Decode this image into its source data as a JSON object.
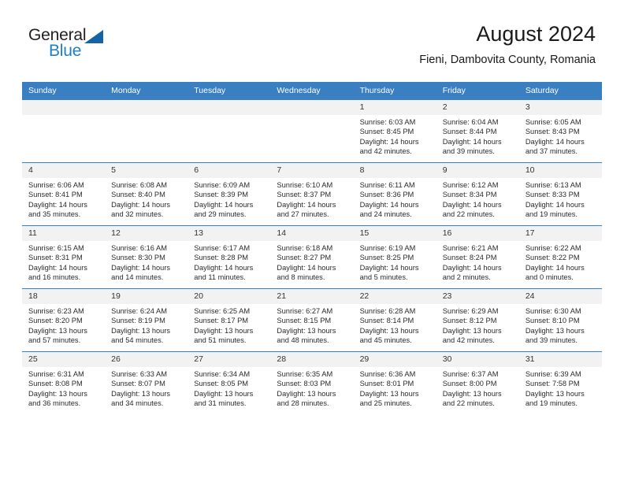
{
  "brand": {
    "name_part1": "General",
    "name_part2": "Blue",
    "triangle_color": "#1464a5",
    "blue_color": "#1f7fc4"
  },
  "header": {
    "title": "August 2024",
    "subtitle": "Fieni, Dambovita County, Romania",
    "header_bg": "#3a7fc1",
    "daynum_bg": "#f2f2f2"
  },
  "weekday_headers": [
    "Sunday",
    "Monday",
    "Tuesday",
    "Wednesday",
    "Thursday",
    "Friday",
    "Saturday"
  ],
  "labels": {
    "sunrise": "Sunrise:",
    "sunset": "Sunset:",
    "daylight": "Daylight:"
  },
  "weeks": [
    [
      {
        "day": "",
        "blank": true
      },
      {
        "day": "",
        "blank": true
      },
      {
        "day": "",
        "blank": true
      },
      {
        "day": "",
        "blank": true
      },
      {
        "day": "1",
        "sunrise": "Sunrise: 6:03 AM",
        "sunset": "Sunset: 8:45 PM",
        "daylight": "Daylight: 14 hours and 42 minutes."
      },
      {
        "day": "2",
        "sunrise": "Sunrise: 6:04 AM",
        "sunset": "Sunset: 8:44 PM",
        "daylight": "Daylight: 14 hours and 39 minutes."
      },
      {
        "day": "3",
        "sunrise": "Sunrise: 6:05 AM",
        "sunset": "Sunset: 8:43 PM",
        "daylight": "Daylight: 14 hours and 37 minutes."
      }
    ],
    [
      {
        "day": "4",
        "sunrise": "Sunrise: 6:06 AM",
        "sunset": "Sunset: 8:41 PM",
        "daylight": "Daylight: 14 hours and 35 minutes."
      },
      {
        "day": "5",
        "sunrise": "Sunrise: 6:08 AM",
        "sunset": "Sunset: 8:40 PM",
        "daylight": "Daylight: 14 hours and 32 minutes."
      },
      {
        "day": "6",
        "sunrise": "Sunrise: 6:09 AM",
        "sunset": "Sunset: 8:39 PM",
        "daylight": "Daylight: 14 hours and 29 minutes."
      },
      {
        "day": "7",
        "sunrise": "Sunrise: 6:10 AM",
        "sunset": "Sunset: 8:37 PM",
        "daylight": "Daylight: 14 hours and 27 minutes."
      },
      {
        "day": "8",
        "sunrise": "Sunrise: 6:11 AM",
        "sunset": "Sunset: 8:36 PM",
        "daylight": "Daylight: 14 hours and 24 minutes."
      },
      {
        "day": "9",
        "sunrise": "Sunrise: 6:12 AM",
        "sunset": "Sunset: 8:34 PM",
        "daylight": "Daylight: 14 hours and 22 minutes."
      },
      {
        "day": "10",
        "sunrise": "Sunrise: 6:13 AM",
        "sunset": "Sunset: 8:33 PM",
        "daylight": "Daylight: 14 hours and 19 minutes."
      }
    ],
    [
      {
        "day": "11",
        "sunrise": "Sunrise: 6:15 AM",
        "sunset": "Sunset: 8:31 PM",
        "daylight": "Daylight: 14 hours and 16 minutes."
      },
      {
        "day": "12",
        "sunrise": "Sunrise: 6:16 AM",
        "sunset": "Sunset: 8:30 PM",
        "daylight": "Daylight: 14 hours and 14 minutes."
      },
      {
        "day": "13",
        "sunrise": "Sunrise: 6:17 AM",
        "sunset": "Sunset: 8:28 PM",
        "daylight": "Daylight: 14 hours and 11 minutes."
      },
      {
        "day": "14",
        "sunrise": "Sunrise: 6:18 AM",
        "sunset": "Sunset: 8:27 PM",
        "daylight": "Daylight: 14 hours and 8 minutes."
      },
      {
        "day": "15",
        "sunrise": "Sunrise: 6:19 AM",
        "sunset": "Sunset: 8:25 PM",
        "daylight": "Daylight: 14 hours and 5 minutes."
      },
      {
        "day": "16",
        "sunrise": "Sunrise: 6:21 AM",
        "sunset": "Sunset: 8:24 PM",
        "daylight": "Daylight: 14 hours and 2 minutes."
      },
      {
        "day": "17",
        "sunrise": "Sunrise: 6:22 AM",
        "sunset": "Sunset: 8:22 PM",
        "daylight": "Daylight: 14 hours and 0 minutes."
      }
    ],
    [
      {
        "day": "18",
        "sunrise": "Sunrise: 6:23 AM",
        "sunset": "Sunset: 8:20 PM",
        "daylight": "Daylight: 13 hours and 57 minutes."
      },
      {
        "day": "19",
        "sunrise": "Sunrise: 6:24 AM",
        "sunset": "Sunset: 8:19 PM",
        "daylight": "Daylight: 13 hours and 54 minutes."
      },
      {
        "day": "20",
        "sunrise": "Sunrise: 6:25 AM",
        "sunset": "Sunset: 8:17 PM",
        "daylight": "Daylight: 13 hours and 51 minutes."
      },
      {
        "day": "21",
        "sunrise": "Sunrise: 6:27 AM",
        "sunset": "Sunset: 8:15 PM",
        "daylight": "Daylight: 13 hours and 48 minutes."
      },
      {
        "day": "22",
        "sunrise": "Sunrise: 6:28 AM",
        "sunset": "Sunset: 8:14 PM",
        "daylight": "Daylight: 13 hours and 45 minutes."
      },
      {
        "day": "23",
        "sunrise": "Sunrise: 6:29 AM",
        "sunset": "Sunset: 8:12 PM",
        "daylight": "Daylight: 13 hours and 42 minutes."
      },
      {
        "day": "24",
        "sunrise": "Sunrise: 6:30 AM",
        "sunset": "Sunset: 8:10 PM",
        "daylight": "Daylight: 13 hours and 39 minutes."
      }
    ],
    [
      {
        "day": "25",
        "sunrise": "Sunrise: 6:31 AM",
        "sunset": "Sunset: 8:08 PM",
        "daylight": "Daylight: 13 hours and 36 minutes."
      },
      {
        "day": "26",
        "sunrise": "Sunrise: 6:33 AM",
        "sunset": "Sunset: 8:07 PM",
        "daylight": "Daylight: 13 hours and 34 minutes."
      },
      {
        "day": "27",
        "sunrise": "Sunrise: 6:34 AM",
        "sunset": "Sunset: 8:05 PM",
        "daylight": "Daylight: 13 hours and 31 minutes."
      },
      {
        "day": "28",
        "sunrise": "Sunrise: 6:35 AM",
        "sunset": "Sunset: 8:03 PM",
        "daylight": "Daylight: 13 hours and 28 minutes."
      },
      {
        "day": "29",
        "sunrise": "Sunrise: 6:36 AM",
        "sunset": "Sunset: 8:01 PM",
        "daylight": "Daylight: 13 hours and 25 minutes."
      },
      {
        "day": "30",
        "sunrise": "Sunrise: 6:37 AM",
        "sunset": "Sunset: 8:00 PM",
        "daylight": "Daylight: 13 hours and 22 minutes."
      },
      {
        "day": "31",
        "sunrise": "Sunrise: 6:39 AM",
        "sunset": "Sunset: 7:58 PM",
        "daylight": "Daylight: 13 hours and 19 minutes."
      }
    ]
  ]
}
